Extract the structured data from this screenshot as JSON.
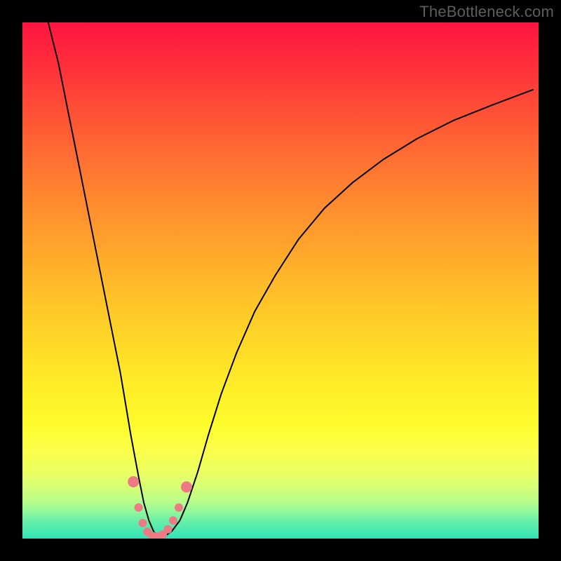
{
  "watermark": "TheBottleneck.com",
  "colors": {
    "background": "#000000",
    "curve": "#000000",
    "curve_width_main": 2,
    "curve_width_thin": 1,
    "marker_fill": "#ee7b83",
    "marker_radius": 6,
    "marker_radius_large": 8
  },
  "chart_data": {
    "type": "line",
    "title": "",
    "xlabel": "",
    "ylabel": "",
    "xlim": [
      0,
      100
    ],
    "ylim": [
      0,
      100
    ],
    "series": [
      {
        "name": "bottleneck-curve",
        "x": [
          5,
          7,
          9,
          11,
          13,
          15,
          17,
          19,
          21,
          22.5,
          23.5,
          24.5,
          25.5,
          26.5,
          27.5,
          29,
          30.5,
          32,
          34,
          36,
          38.5,
          41.5,
          45,
          49,
          53.5,
          58.5,
          64,
          70,
          76.5,
          83.5,
          91,
          99
        ],
        "values": [
          100,
          92,
          82,
          72,
          62,
          52,
          42,
          32,
          20,
          12,
          7,
          3.5,
          1.2,
          0.4,
          0.4,
          1.5,
          3.5,
          7,
          13,
          20,
          28,
          36,
          44,
          51,
          58,
          64,
          69,
          73.5,
          77.5,
          81,
          84,
          87
        ]
      }
    ],
    "markers": {
      "name": "highlight-points",
      "points": [
        {
          "x": 21.5,
          "y": 11
        },
        {
          "x": 22.5,
          "y": 6
        },
        {
          "x": 23.3,
          "y": 3
        },
        {
          "x": 24.2,
          "y": 1.3
        },
        {
          "x": 25.2,
          "y": 0.5
        },
        {
          "x": 26.2,
          "y": 0.4
        },
        {
          "x": 27.2,
          "y": 0.8
        },
        {
          "x": 28.2,
          "y": 1.8
        },
        {
          "x": 29.2,
          "y": 3.5
        },
        {
          "x": 30.3,
          "y": 6
        },
        {
          "x": 31.8,
          "y": 10
        }
      ]
    }
  }
}
